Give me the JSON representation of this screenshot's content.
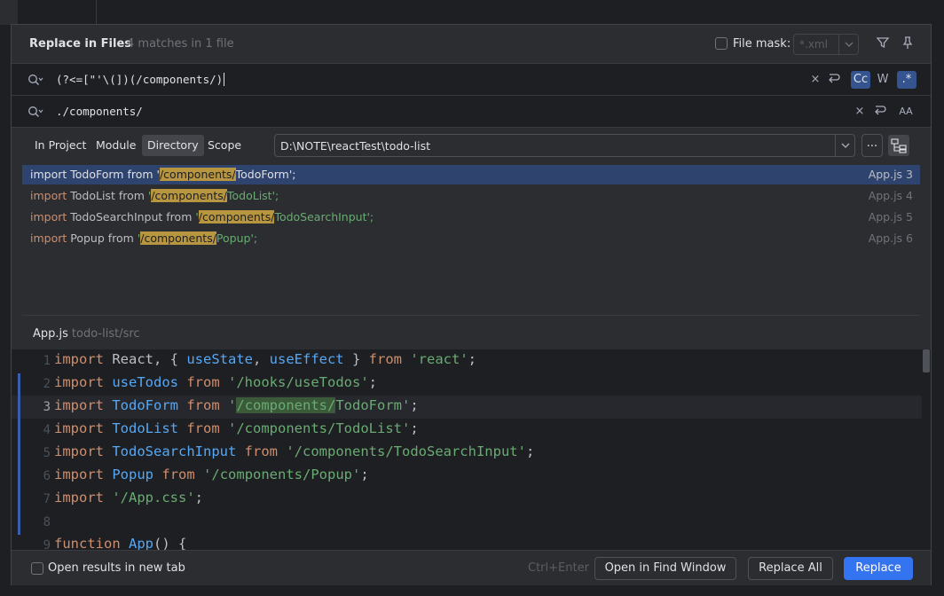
{
  "dialog": {
    "title": "Replace in Files",
    "match_summary": "4 matches in 1 file",
    "file_mask_label": "File mask:",
    "file_mask_placeholder": "*.xml"
  },
  "search": {
    "query": "(?<=[\"'\\(])(/components/)",
    "replace": "./components/",
    "options": {
      "match_case_label": "Cc",
      "words_label": "W",
      "regex_label": ".*",
      "match_case_on": true,
      "words_on": false,
      "regex_on": true
    }
  },
  "scope": {
    "tabs": [
      "In Project",
      "Module",
      "Directory",
      "Scope"
    ],
    "selected": "Directory",
    "directory": "D:\\NOTE\\reactTest\\todo-list",
    "browse_label": "..."
  },
  "results": [
    {
      "pre_kw": "import",
      "name": " TodoForm from ",
      "q": "'",
      "match": "/components/",
      "rest": "TodoForm",
      "end": "';",
      "file": "App.js 3",
      "selected": true
    },
    {
      "pre_kw": "import",
      "name": " TodoList from ",
      "q": "'",
      "match": "/components/",
      "rest": "TodoList",
      "end": "';",
      "file": "App.js 4",
      "selected": false
    },
    {
      "pre_kw": "import",
      "name": " TodoSearchInput from ",
      "q": "'",
      "match": "/components/",
      "rest": "TodoSearchInput",
      "end": "';",
      "file": "App.js 5",
      "selected": false
    },
    {
      "pre_kw": "import",
      "name": " Popup from ",
      "q": "'",
      "match": "/components/",
      "rest": "Popup",
      "end": "';",
      "file": "App.js 6",
      "selected": false
    }
  ],
  "preview": {
    "file_name": "App.js",
    "file_path": "todo-list/src",
    "lines": [
      {
        "n": "1",
        "html": "<span class='kw'>import</span> React, { <span class='id'>useState</span>, <span class='id'>useEffect</span> } <span class='kw'>from</span> <span class='str'>'react'</span>;"
      },
      {
        "n": "2",
        "html": "<span class='kw'>import</span> <span class='id'>useTodos</span> <span class='kw'>from</span> <span class='str'>'/hooks/useTodos'</span>;"
      },
      {
        "n": "3",
        "html": "<span class='kw'>import</span> <span class='id'>TodoForm</span> <span class='kw'>from</span> <span class='str'>'<span class='ed-hl'>/components/</span>TodoForm'</span>;"
      },
      {
        "n": "4",
        "html": "<span class='kw'>import</span> <span class='id'>TodoList</span> <span class='kw'>from</span> <span class='str'>'/components/TodoList'</span>;"
      },
      {
        "n": "5",
        "html": "<span class='kw'>import</span> <span class='id'>TodoSearchInput</span> <span class='kw'>from</span> <span class='str'>'/components/TodoSearchInput'</span>;"
      },
      {
        "n": "6",
        "html": "<span class='kw'>import</span> <span class='id'>Popup</span> <span class='kw'>from</span> <span class='str'>'/components/Popup'</span>;"
      },
      {
        "n": "7",
        "html": "<span class='kw'>import</span> <span class='str'>'/App.css'</span>;"
      },
      {
        "n": "8",
        "html": ""
      },
      {
        "n": "9",
        "html": "<span class='kw'>function</span> <span class='fn'>App</span>() {"
      }
    ]
  },
  "footer": {
    "open_new_tab_label": "Open results in new tab",
    "shortcut_hint": "Ctrl+Enter",
    "open_find_window_label": "Open in Find Window",
    "replace_all_label": "Replace All",
    "replace_label": "Replace"
  }
}
